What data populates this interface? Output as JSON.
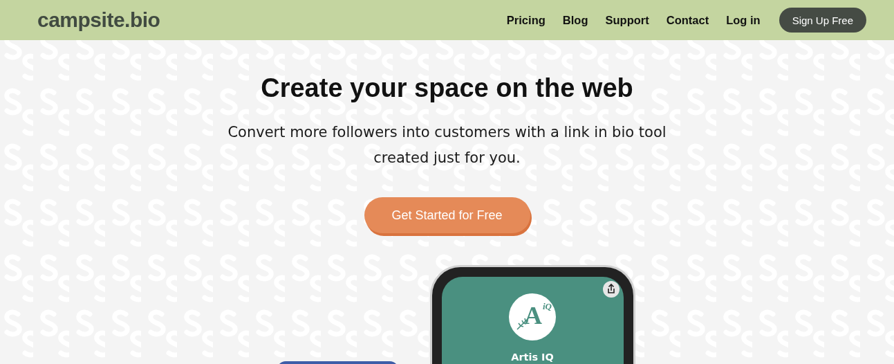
{
  "header": {
    "logo": "campsite.bio",
    "nav": [
      "Pricing",
      "Blog",
      "Support",
      "Contact",
      "Log in"
    ],
    "signup_button": "Sign Up Free"
  },
  "hero": {
    "title": "Create your space on the web",
    "subtitle": "Convert more followers into customers with a link in bio tool created just for you.",
    "cta": "Get Started for Free"
  },
  "preview": {
    "avatar_letter": "A",
    "avatar_sub": "iQ",
    "profile_name": "Artis IQ"
  }
}
